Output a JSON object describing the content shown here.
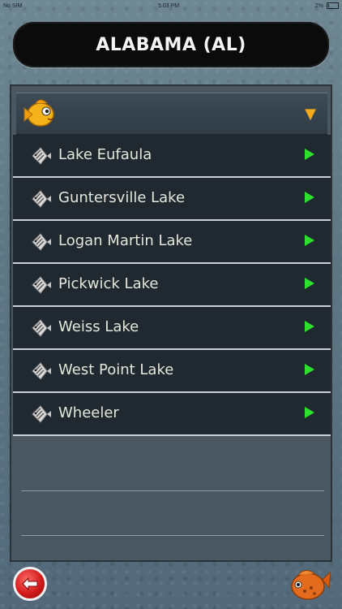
{
  "status": {
    "carrier": "No SIM",
    "time": "5:03 PM",
    "battery": "2%"
  },
  "header": {
    "title": "ALABAMA (AL)"
  },
  "dropdown": {
    "icon": "goldfish-icon",
    "arrow": "chevron-down-icon",
    "value": ""
  },
  "lakes": [
    {
      "label": "Lake Eufaula"
    },
    {
      "label": "Guntersville Lake"
    },
    {
      "label": "Logan Martin Lake"
    },
    {
      "label": "Pickwick Lake"
    },
    {
      "label": "Weiss Lake"
    },
    {
      "label": "West Point Lake"
    },
    {
      "label": "Wheeler"
    }
  ],
  "footer": {
    "back_icon": "back-arrow-icon",
    "logo_icon": "orange-fish-icon"
  },
  "colors": {
    "accent": "#2ee02e",
    "arrow": "#f2a91b",
    "title_bg": "#0b0b0b"
  }
}
